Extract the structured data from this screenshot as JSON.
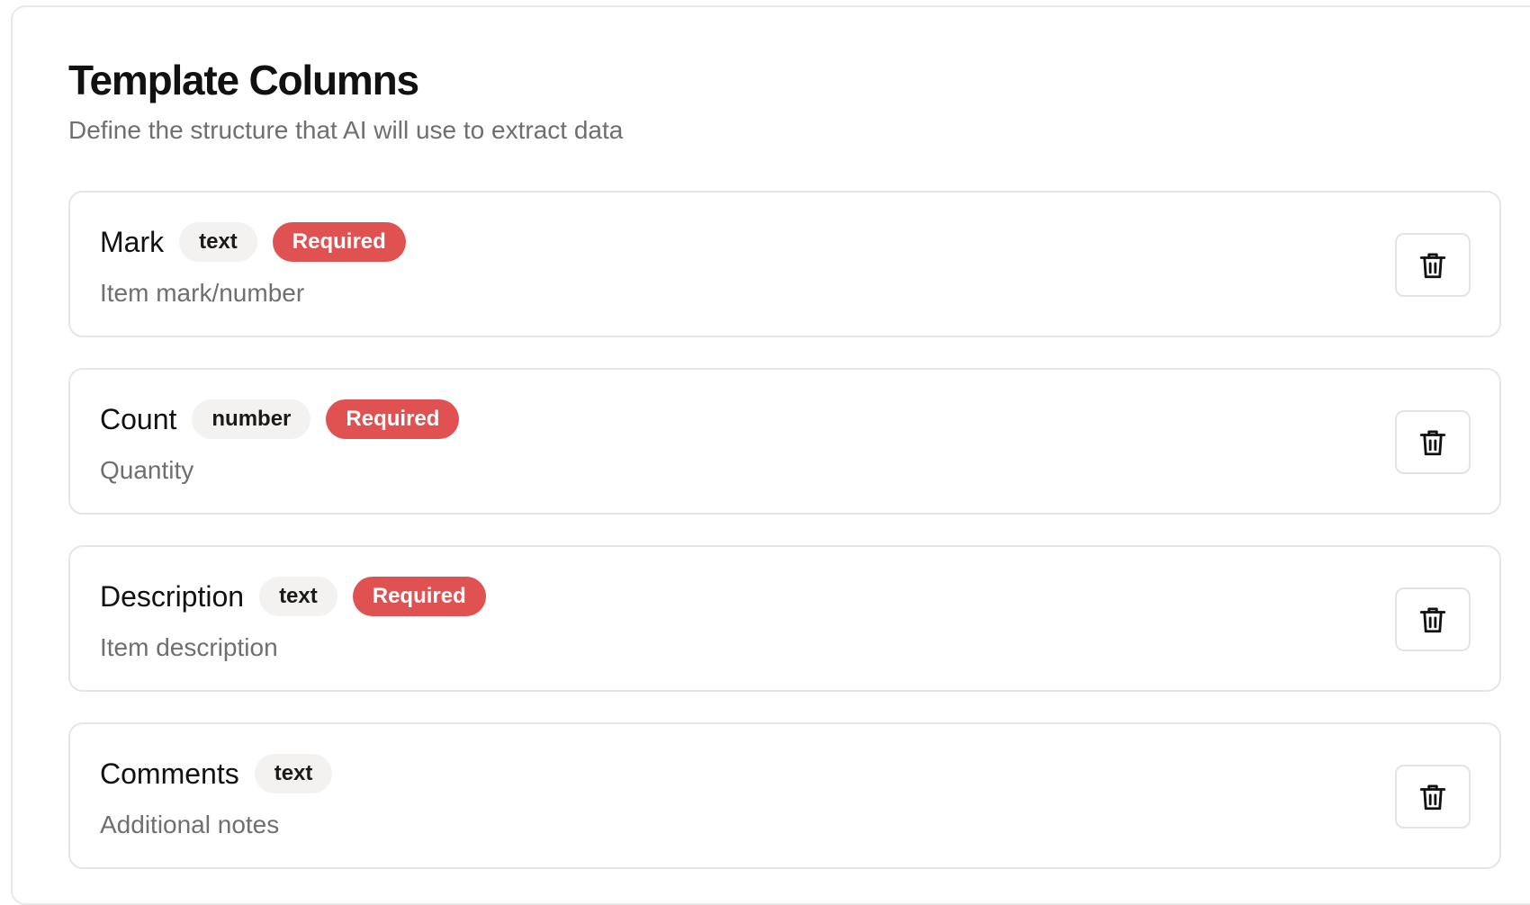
{
  "section": {
    "title": "Template Columns",
    "subtitle": "Define the structure that AI will use to extract data"
  },
  "colors": {
    "required_badge": "#e05252",
    "type_badge_bg": "#f3f2f1",
    "muted_text": "#6f6f6f"
  },
  "columns": [
    {
      "name": "Mark",
      "type": "text",
      "required": true,
      "required_label": "Required",
      "description": "Item mark/number",
      "delete_icon": "trash-icon"
    },
    {
      "name": "Count",
      "type": "number",
      "required": true,
      "required_label": "Required",
      "description": "Quantity",
      "delete_icon": "trash-icon"
    },
    {
      "name": "Description",
      "type": "text",
      "required": true,
      "required_label": "Required",
      "description": "Item description",
      "delete_icon": "trash-icon"
    },
    {
      "name": "Comments",
      "type": "text",
      "required": false,
      "required_label": "",
      "description": "Additional notes",
      "delete_icon": "trash-icon"
    }
  ]
}
